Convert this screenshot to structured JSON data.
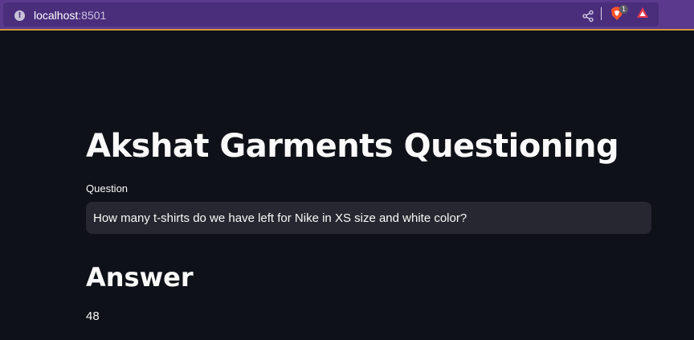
{
  "browser": {
    "url_host": "localhost",
    "url_port": ":8501",
    "brave_badge": "1",
    "icons": [
      "info-icon",
      "share-icon",
      "brave-shields-icon",
      "brave-rewards-icon"
    ]
  },
  "page": {
    "title": "Akshat Garments Questioning",
    "question_label": "Question",
    "question_value": "How many t-shirts do we have left for Nike in XS size and white color?",
    "answer_heading": "Answer",
    "answer_value": "48"
  },
  "colors": {
    "background": "#0e1117",
    "browser_bar": "#5b3a8e",
    "input_bg": "#262730",
    "text": "#fafafa"
  }
}
